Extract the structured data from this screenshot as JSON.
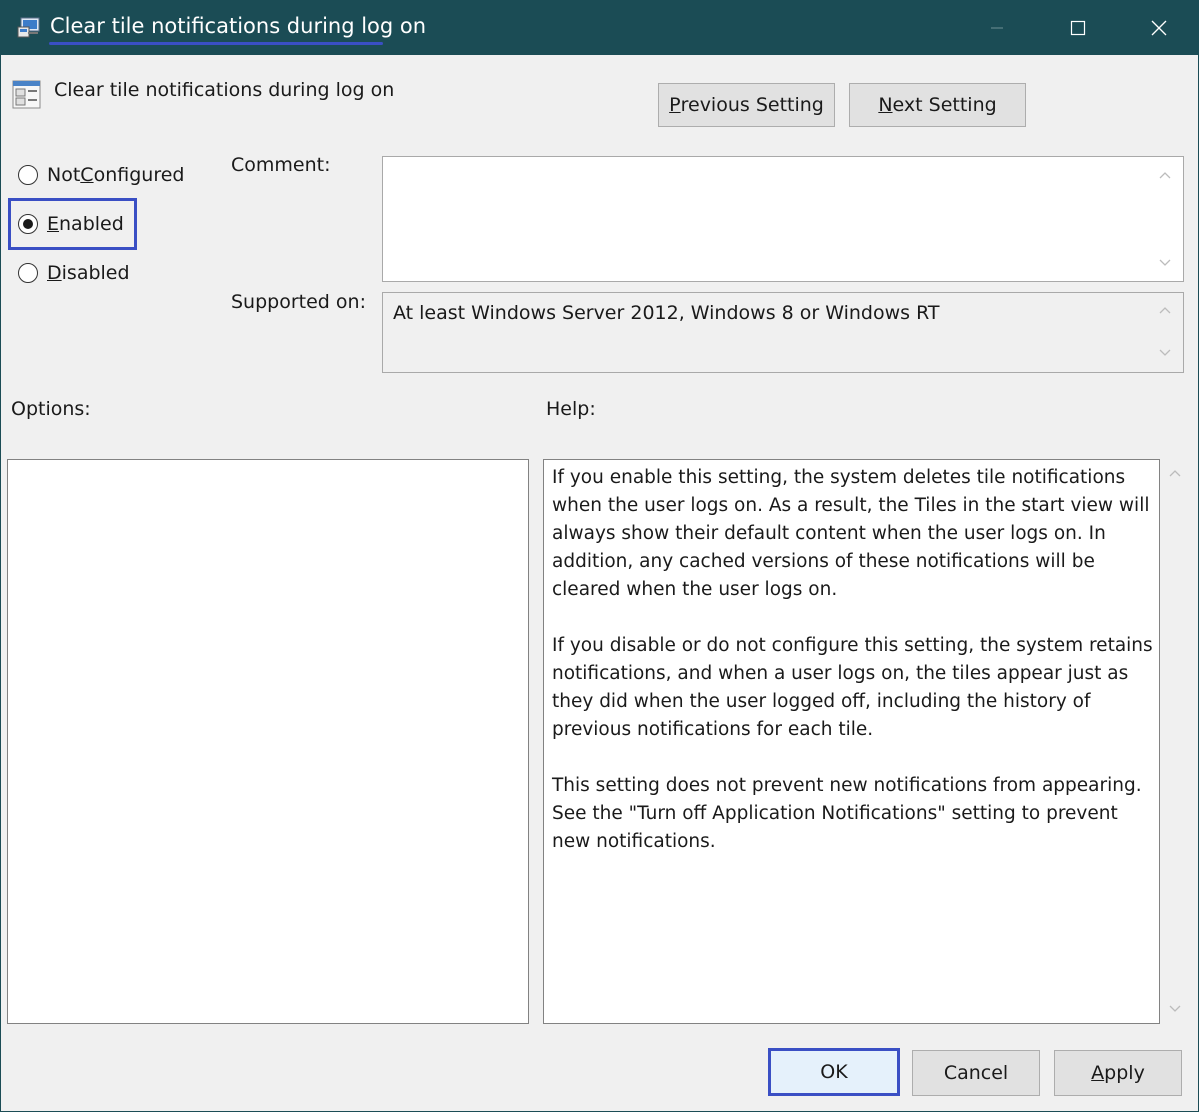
{
  "window": {
    "title": "Clear tile notifications during log on",
    "controls": {
      "minimize": "minimize-icon",
      "maximize": "maximize-icon",
      "close": "close-icon"
    }
  },
  "header": {
    "title": "Clear tile notifications during log on",
    "previous_button": {
      "pre": "",
      "key": "P",
      "post": "revious Setting"
    },
    "next_button": {
      "pre": "",
      "key": "N",
      "post": "ext Setting"
    }
  },
  "state": {
    "options": [
      {
        "pre": "Not ",
        "key": "C",
        "post": "onfigured",
        "selected": false
      },
      {
        "pre": "",
        "key": "E",
        "post": "nabled",
        "selected": true
      },
      {
        "pre": "",
        "key": "D",
        "post": "isabled",
        "selected": false
      }
    ]
  },
  "comment": {
    "label": "Comment:",
    "value": ""
  },
  "supported": {
    "label": "Supported on:",
    "value": "At least Windows Server 2012, Windows 8 or Windows RT"
  },
  "options_panel": {
    "label": "Options:"
  },
  "help_panel": {
    "label": "Help:",
    "paragraphs": [
      "If you enable this setting, the system deletes tile notifications when the user logs on. As a result, the Tiles in the start view will always show their default content when the user logs on. In addition, any cached versions of these notifications will be cleared when the user logs on.",
      "If you disable or do not configure this setting, the system retains notifications, and when a user logs on, the tiles appear just as they did when the user logged off, including the history of previous notifications for each tile.",
      "This setting does not prevent new notifications from appearing. See the \"Turn off Application Notifications\" setting to prevent new notifications."
    ]
  },
  "footer": {
    "ok": "OK",
    "cancel": "Cancel",
    "apply": {
      "pre": "",
      "key": "A",
      "post": "pply"
    }
  },
  "colors": {
    "titlebar": "#1b4c55",
    "highlight": "#3a4fc4",
    "dialog_bg": "#f0f0f0"
  }
}
